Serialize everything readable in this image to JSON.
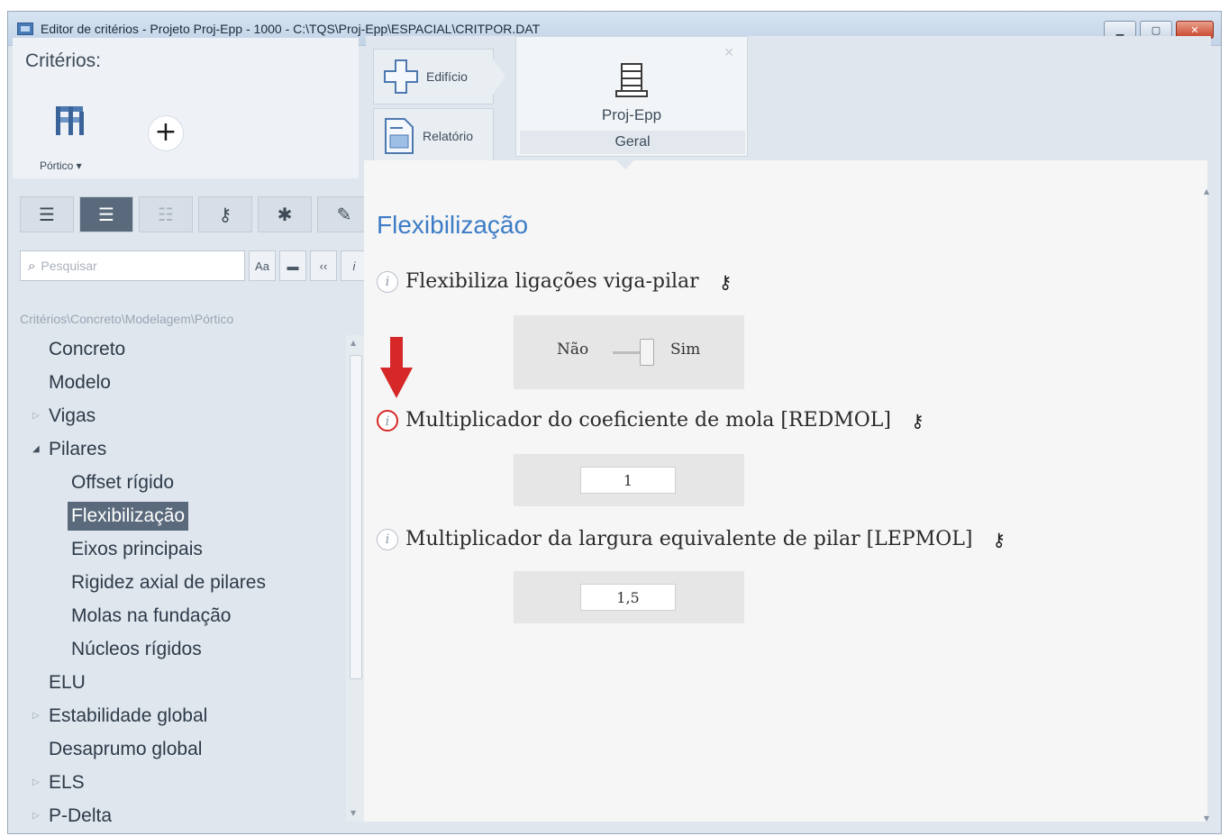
{
  "window": {
    "title": "Editor de critérios - Projeto Proj-Epp - 1000 - C:\\TQS\\Proj-Epp\\ESPACIAL\\CRITPOR.DAT",
    "controls": [
      "minimize-icon",
      "maximize-icon",
      "close-icon"
    ]
  },
  "left": {
    "criteria_label": "Critérios:",
    "portico_label": "Pórtico ▾",
    "view_buttons": [
      "list-icon",
      "list-indent-icon",
      "list-compact-icon",
      "key-icon",
      "asterisk-icon",
      "pencil-icon"
    ],
    "search": {
      "placeholder": "Pesquisar",
      "value": ""
    },
    "search_tools": [
      "Aa",
      "▬",
      "‹‹",
      "i"
    ],
    "breadcrumb": "Critérios\\Concreto\\Modelagem\\Pórtico",
    "tree": [
      {
        "label": "Concreto",
        "level": 1,
        "arrow": ""
      },
      {
        "label": "Modelo",
        "level": 1,
        "arrow": ""
      },
      {
        "label": "Vigas",
        "level": 1,
        "arrow": "▷"
      },
      {
        "label": "Pilares",
        "level": 1,
        "arrow": "◢"
      },
      {
        "label": "Offset rígido",
        "level": 2,
        "arrow": ""
      },
      {
        "label": "Flexibilização",
        "level": 2,
        "arrow": "",
        "selected": true
      },
      {
        "label": "Eixos principais",
        "level": 2,
        "arrow": ""
      },
      {
        "label": "Rigidez axial de pilares",
        "level": 2,
        "arrow": ""
      },
      {
        "label": "Molas na fundação",
        "level": 2,
        "arrow": ""
      },
      {
        "label": "Núcleos rígidos",
        "level": 2,
        "arrow": ""
      },
      {
        "label": "ELU",
        "level": 1,
        "arrow": ""
      },
      {
        "label": "Estabilidade global",
        "level": 1,
        "arrow": "▷"
      },
      {
        "label": "Desaprumo global",
        "level": 1,
        "arrow": ""
      },
      {
        "label": "ELS",
        "level": 1,
        "arrow": "▷"
      },
      {
        "label": "P-Delta",
        "level": 1,
        "arrow": "▷"
      }
    ]
  },
  "topbar": {
    "edificio_label": "Edifício",
    "relatorio_label": "Relatório",
    "project_name": "Proj-Epp",
    "project_sub": "Geral"
  },
  "content": {
    "section_title": "Flexibilização",
    "params": [
      {
        "label": "Flexibiliza ligações viga-pilar",
        "type": "toggle",
        "off_label": "Não",
        "on_label": "Sim",
        "state": "Sim"
      },
      {
        "label": "Multiplicador do coeficiente de mola [REDMOL]",
        "type": "number",
        "value": "1"
      },
      {
        "label": "Multiplicador da largura equivalente de pilar [LEPMOL]",
        "type": "number",
        "value": "1,5"
      }
    ]
  },
  "colors": {
    "accent_blue": "#3d7cc6",
    "highlight_red": "#d62828",
    "selected_bg": "#5a6a7c"
  }
}
